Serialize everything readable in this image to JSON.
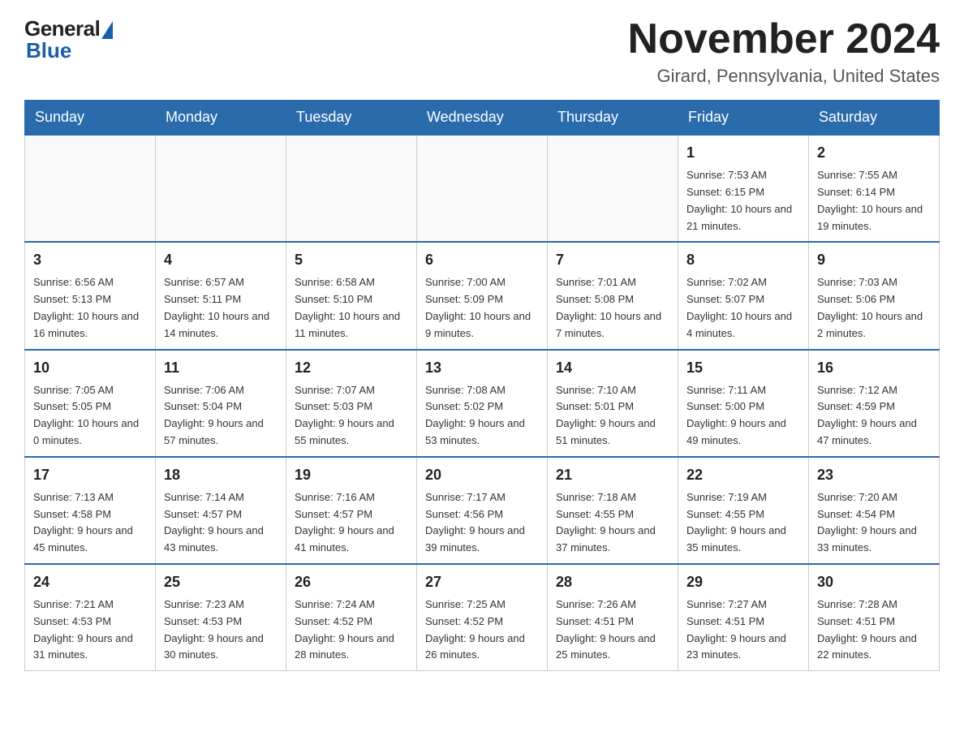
{
  "logo": {
    "general": "General",
    "blue": "Blue"
  },
  "header": {
    "month_title": "November 2024",
    "location": "Girard, Pennsylvania, United States"
  },
  "weekdays": [
    "Sunday",
    "Monday",
    "Tuesday",
    "Wednesday",
    "Thursday",
    "Friday",
    "Saturday"
  ],
  "weeks": [
    [
      {
        "day": "",
        "info": ""
      },
      {
        "day": "",
        "info": ""
      },
      {
        "day": "",
        "info": ""
      },
      {
        "day": "",
        "info": ""
      },
      {
        "day": "",
        "info": ""
      },
      {
        "day": "1",
        "info": "Sunrise: 7:53 AM\nSunset: 6:15 PM\nDaylight: 10 hours and 21 minutes."
      },
      {
        "day": "2",
        "info": "Sunrise: 7:55 AM\nSunset: 6:14 PM\nDaylight: 10 hours and 19 minutes."
      }
    ],
    [
      {
        "day": "3",
        "info": "Sunrise: 6:56 AM\nSunset: 5:13 PM\nDaylight: 10 hours and 16 minutes."
      },
      {
        "day": "4",
        "info": "Sunrise: 6:57 AM\nSunset: 5:11 PM\nDaylight: 10 hours and 14 minutes."
      },
      {
        "day": "5",
        "info": "Sunrise: 6:58 AM\nSunset: 5:10 PM\nDaylight: 10 hours and 11 minutes."
      },
      {
        "day": "6",
        "info": "Sunrise: 7:00 AM\nSunset: 5:09 PM\nDaylight: 10 hours and 9 minutes."
      },
      {
        "day": "7",
        "info": "Sunrise: 7:01 AM\nSunset: 5:08 PM\nDaylight: 10 hours and 7 minutes."
      },
      {
        "day": "8",
        "info": "Sunrise: 7:02 AM\nSunset: 5:07 PM\nDaylight: 10 hours and 4 minutes."
      },
      {
        "day": "9",
        "info": "Sunrise: 7:03 AM\nSunset: 5:06 PM\nDaylight: 10 hours and 2 minutes."
      }
    ],
    [
      {
        "day": "10",
        "info": "Sunrise: 7:05 AM\nSunset: 5:05 PM\nDaylight: 10 hours and 0 minutes."
      },
      {
        "day": "11",
        "info": "Sunrise: 7:06 AM\nSunset: 5:04 PM\nDaylight: 9 hours and 57 minutes."
      },
      {
        "day": "12",
        "info": "Sunrise: 7:07 AM\nSunset: 5:03 PM\nDaylight: 9 hours and 55 minutes."
      },
      {
        "day": "13",
        "info": "Sunrise: 7:08 AM\nSunset: 5:02 PM\nDaylight: 9 hours and 53 minutes."
      },
      {
        "day": "14",
        "info": "Sunrise: 7:10 AM\nSunset: 5:01 PM\nDaylight: 9 hours and 51 minutes."
      },
      {
        "day": "15",
        "info": "Sunrise: 7:11 AM\nSunset: 5:00 PM\nDaylight: 9 hours and 49 minutes."
      },
      {
        "day": "16",
        "info": "Sunrise: 7:12 AM\nSunset: 4:59 PM\nDaylight: 9 hours and 47 minutes."
      }
    ],
    [
      {
        "day": "17",
        "info": "Sunrise: 7:13 AM\nSunset: 4:58 PM\nDaylight: 9 hours and 45 minutes."
      },
      {
        "day": "18",
        "info": "Sunrise: 7:14 AM\nSunset: 4:57 PM\nDaylight: 9 hours and 43 minutes."
      },
      {
        "day": "19",
        "info": "Sunrise: 7:16 AM\nSunset: 4:57 PM\nDaylight: 9 hours and 41 minutes."
      },
      {
        "day": "20",
        "info": "Sunrise: 7:17 AM\nSunset: 4:56 PM\nDaylight: 9 hours and 39 minutes."
      },
      {
        "day": "21",
        "info": "Sunrise: 7:18 AM\nSunset: 4:55 PM\nDaylight: 9 hours and 37 minutes."
      },
      {
        "day": "22",
        "info": "Sunrise: 7:19 AM\nSunset: 4:55 PM\nDaylight: 9 hours and 35 minutes."
      },
      {
        "day": "23",
        "info": "Sunrise: 7:20 AM\nSunset: 4:54 PM\nDaylight: 9 hours and 33 minutes."
      }
    ],
    [
      {
        "day": "24",
        "info": "Sunrise: 7:21 AM\nSunset: 4:53 PM\nDaylight: 9 hours and 31 minutes."
      },
      {
        "day": "25",
        "info": "Sunrise: 7:23 AM\nSunset: 4:53 PM\nDaylight: 9 hours and 30 minutes."
      },
      {
        "day": "26",
        "info": "Sunrise: 7:24 AM\nSunset: 4:52 PM\nDaylight: 9 hours and 28 minutes."
      },
      {
        "day": "27",
        "info": "Sunrise: 7:25 AM\nSunset: 4:52 PM\nDaylight: 9 hours and 26 minutes."
      },
      {
        "day": "28",
        "info": "Sunrise: 7:26 AM\nSunset: 4:51 PM\nDaylight: 9 hours and 25 minutes."
      },
      {
        "day": "29",
        "info": "Sunrise: 7:27 AM\nSunset: 4:51 PM\nDaylight: 9 hours and 23 minutes."
      },
      {
        "day": "30",
        "info": "Sunrise: 7:28 AM\nSunset: 4:51 PM\nDaylight: 9 hours and 22 minutes."
      }
    ]
  ]
}
